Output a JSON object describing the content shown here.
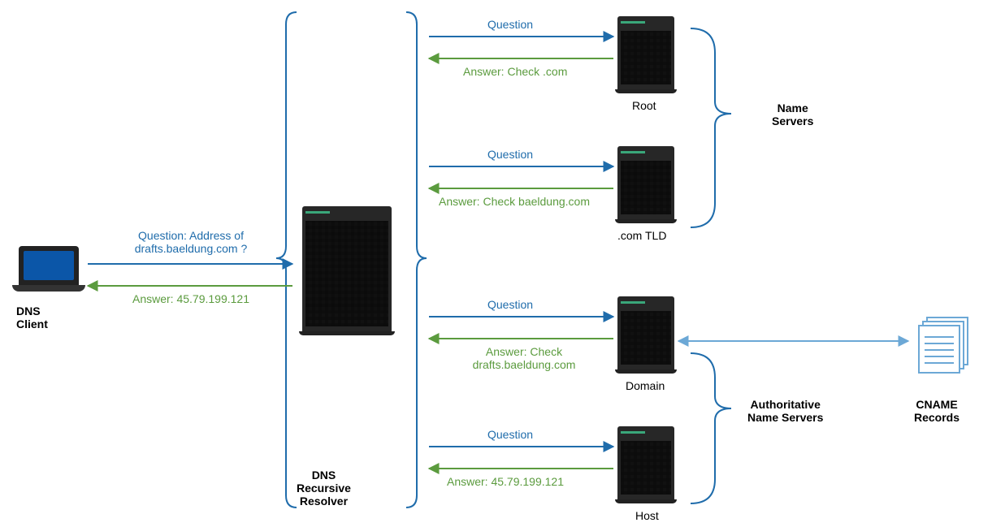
{
  "client": {
    "label": "DNS\nClient",
    "question": "Question: Address of\ndrafts.baeldung.com ?",
    "answer": "Answer: 45.79.199.121"
  },
  "resolver": {
    "label": "DNS\nRecursive\nResolver"
  },
  "servers": {
    "root": {
      "label": "Root",
      "question": "Question",
      "answer": "Answer: Check .com"
    },
    "tld": {
      "label": ".com TLD",
      "question": "Question",
      "answer": "Answer: Check baeldung.com"
    },
    "domain": {
      "label": "Domain",
      "question": "Question",
      "answer": "Answer: Check\ndrafts.baeldung.com"
    },
    "host": {
      "label": "Host",
      "question": "Question",
      "answer": "Answer: 45.79.199.121"
    }
  },
  "groups": {
    "name_servers": "Name\nServers",
    "authoritative": "Authoritative\nName Servers"
  },
  "cname": {
    "label": "CNAME\nRecords"
  }
}
